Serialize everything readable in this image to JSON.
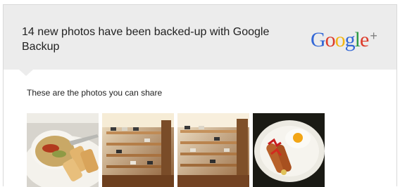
{
  "header": {
    "title": "14 new photos have been backed-up with Google Backup",
    "logo_letters": [
      "G",
      "o",
      "o",
      "g",
      "l",
      "e"
    ],
    "logo_plus": "+",
    "logo_colors": [
      "#3468d6",
      "#dd3b2a",
      "#f3b513",
      "#3468d6",
      "#2b9a44",
      "#dd3b2a"
    ]
  },
  "body": {
    "subtitle": "These are the photos you can share"
  },
  "photos": [
    {
      "subject": "soup-and-spring-rolls"
    },
    {
      "subject": "shoe-display-shelves"
    },
    {
      "subject": "shoe-display-shelves-alt"
    },
    {
      "subject": "fried-egg-and-sausage"
    }
  ],
  "colors": {
    "header_bg": "#ececec",
    "card_border": "#d9d9d9",
    "text": "#222222"
  }
}
